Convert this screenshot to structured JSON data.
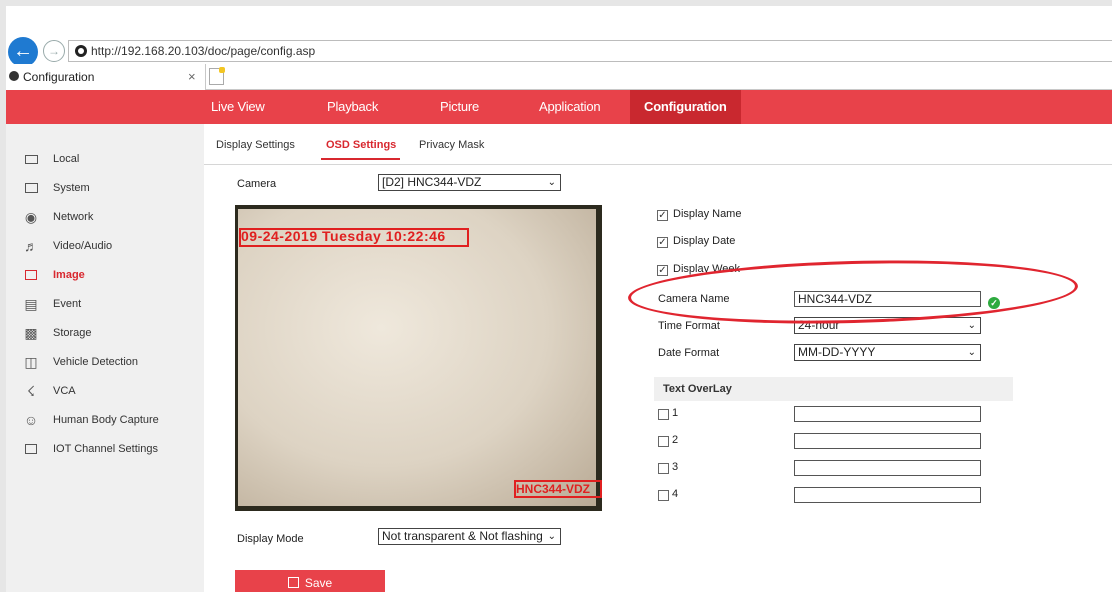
{
  "browser": {
    "url": "http://192.168.20.103/doc/page/config.asp",
    "tab_title": "Configuration",
    "tab_close": "×"
  },
  "nav": {
    "items": [
      "Live View",
      "Playback",
      "Picture",
      "Application",
      "Configuration"
    ],
    "active": "Configuration"
  },
  "sidebar": {
    "items": [
      {
        "label": "Local",
        "icon": "monitor-icon"
      },
      {
        "label": "System",
        "icon": "system-icon"
      },
      {
        "label": "Network",
        "icon": "network-icon"
      },
      {
        "label": "Video/Audio",
        "icon": "video-audio-icon"
      },
      {
        "label": "Image",
        "icon": "image-icon"
      },
      {
        "label": "Event",
        "icon": "event-icon"
      },
      {
        "label": "Storage",
        "icon": "storage-icon"
      },
      {
        "label": "Vehicle Detection",
        "icon": "vehicle-detection-icon"
      },
      {
        "label": "VCA",
        "icon": "vca-icon"
      },
      {
        "label": "Human Body Capture",
        "icon": "human-body-icon"
      },
      {
        "label": "IOT Channel Settings",
        "icon": "iot-icon"
      }
    ],
    "active": "Image"
  },
  "subtabs": {
    "items": [
      "Display Settings",
      "OSD Settings",
      "Privacy Mask"
    ],
    "active": "OSD Settings"
  },
  "camera": {
    "label": "Camera",
    "value": "[D2] HNC344-VDZ"
  },
  "preview": {
    "osd_date": "09-24-2019 Tuesday 10:22:46",
    "osd_name": "HNC344-VDZ"
  },
  "display_mode": {
    "label": "Display Mode",
    "value": "Not transparent & Not flashing"
  },
  "checks": {
    "display_name": {
      "label": "Display Name",
      "checked": true
    },
    "display_date": {
      "label": "Display Date",
      "checked": true
    },
    "display_week": {
      "label": "Display Week",
      "checked": true
    }
  },
  "form": {
    "camera_name_label": "Camera Name",
    "camera_name_value": "HNC344-VDZ",
    "time_format_label": "Time Format",
    "time_format_value": "24-hour",
    "date_format_label": "Date Format",
    "date_format_value": "MM-DD-YYYY"
  },
  "text_overlay": {
    "title": "Text OverLay",
    "rows": [
      "1",
      "2",
      "3",
      "4"
    ]
  },
  "save_label": "Save",
  "colors": {
    "accent": "#e8424a",
    "active_nav": "#c9282f",
    "highlight": "#e0252f",
    "ok": "#2eaa3f"
  }
}
